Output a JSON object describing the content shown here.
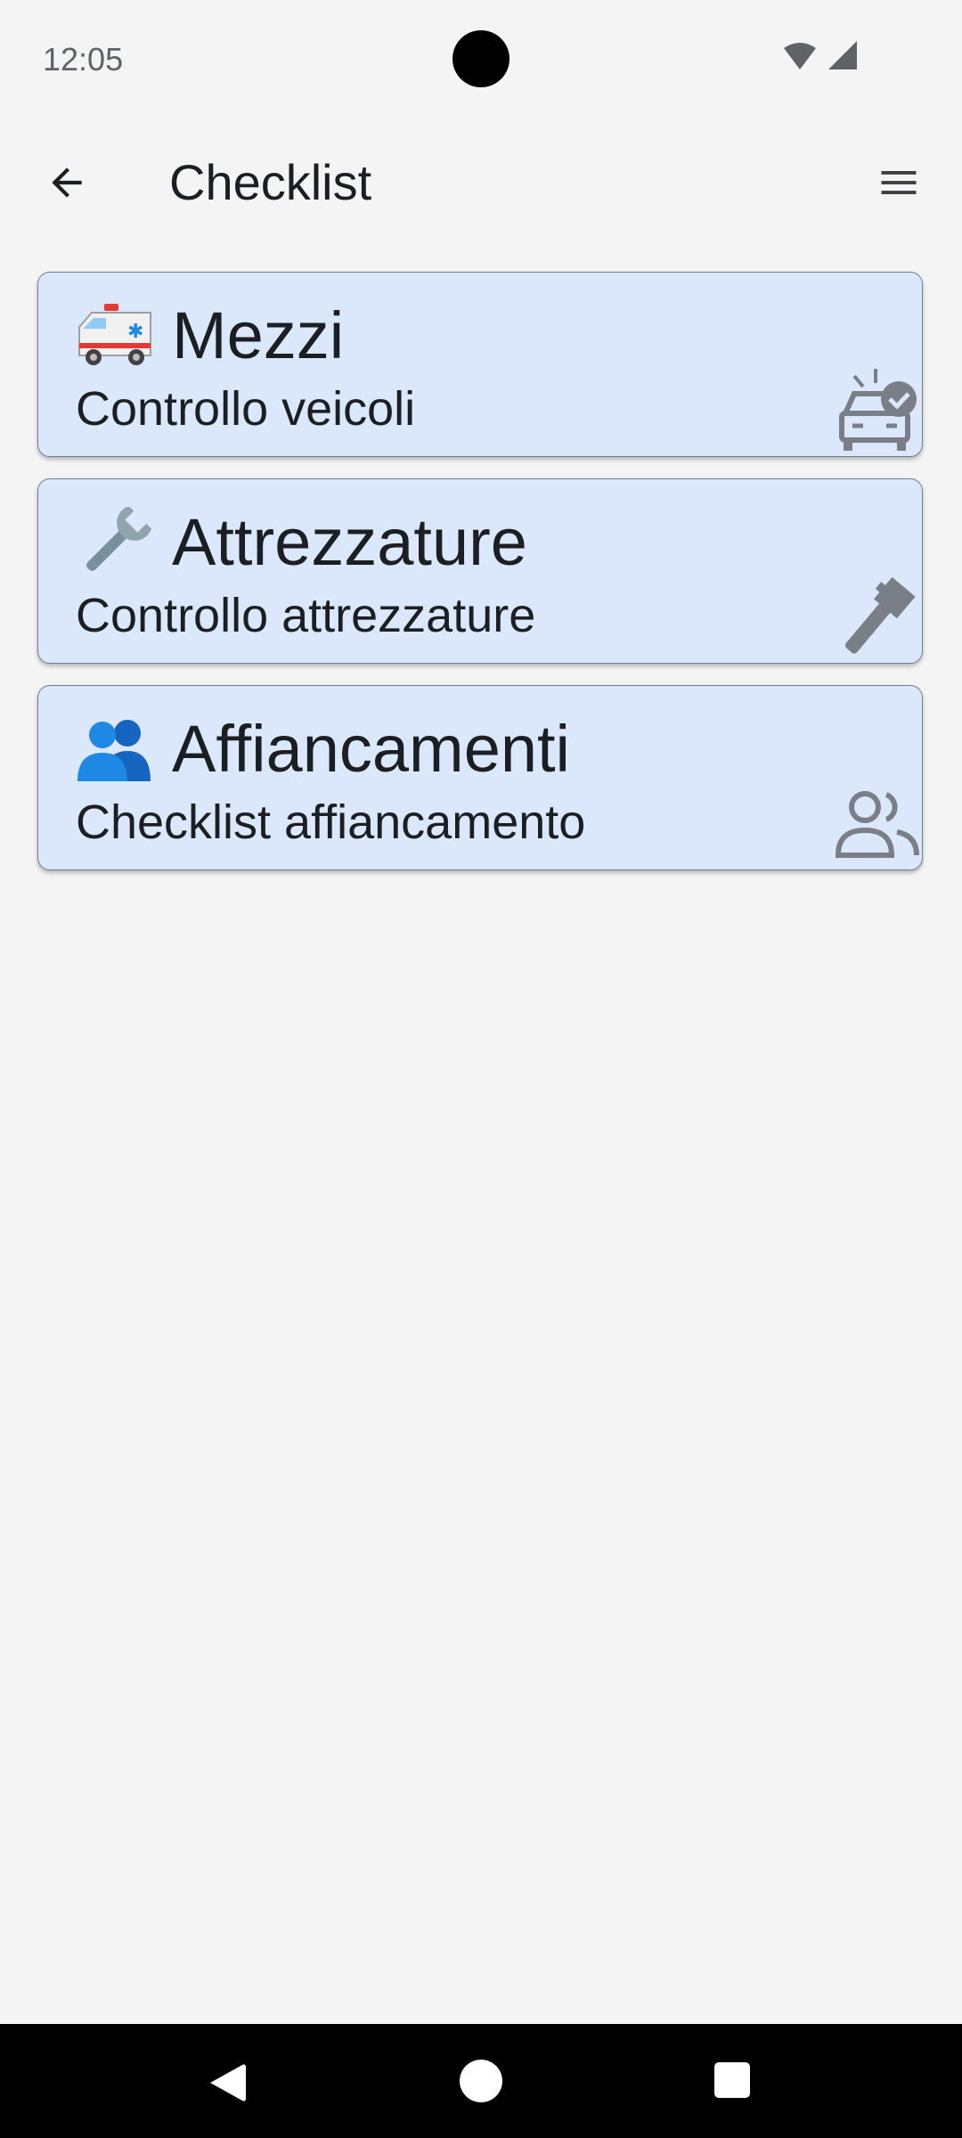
{
  "status_bar": {
    "time": "12:05",
    "wifi_icon": "wifi-icon",
    "signal_icon": "cell-signal-icon"
  },
  "app_bar": {
    "title": "Checklist",
    "back_icon": "arrow-back-icon",
    "menu_icon": "hamburger-menu-icon"
  },
  "cards": [
    {
      "emoji": "ambulance-emoji",
      "title": "Mezzi",
      "subtitle": "Controllo veicoli",
      "side_icon": "car-check-icon"
    },
    {
      "emoji": "wrench-emoji",
      "title": "Attrezzature",
      "subtitle": "Controllo attrezzature",
      "side_icon": "pipe-wrench-icon"
    },
    {
      "emoji": "people-emoji",
      "title": "Affiancamenti",
      "subtitle": "Checklist affiancamento",
      "side_icon": "people-outline-icon"
    }
  ],
  "colors": {
    "background": "#f4f4f4",
    "card_background": "#dbe8fb",
    "card_border": "#6f7e95",
    "text": "#1b1f24",
    "side_icon": "#7a7f87",
    "nav_bar": "#000000"
  }
}
